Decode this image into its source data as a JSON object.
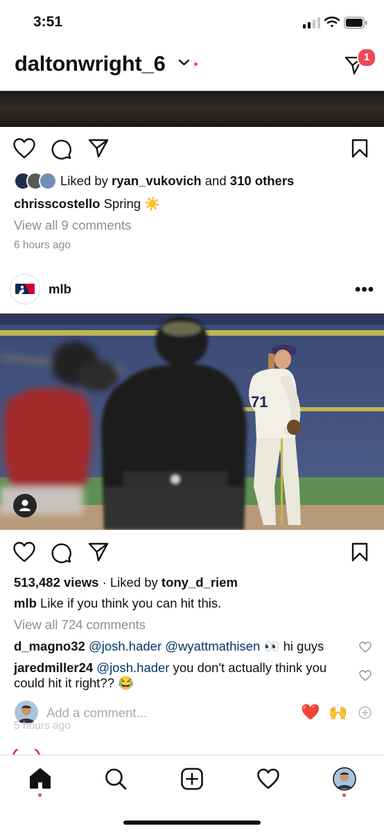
{
  "status_bar": {
    "time": "3:51",
    "signal_icon": "cellular-signal-icon",
    "wifi_icon": "wifi-icon",
    "battery_icon": "battery-icon"
  },
  "header": {
    "username": "daltonwright_6",
    "switch_account_icon": "chevron-down-icon",
    "direct_icon": "paper-plane-icon",
    "direct_badge": "1"
  },
  "post1": {
    "liked_prefix": "Liked by",
    "liked_user": "ryan_vukovich",
    "liked_and": "and",
    "liked_others": "310 others",
    "caption_user": "chrisscostello",
    "caption_text": "Spring",
    "caption_emoji": "☀️",
    "view_all": "View all 9 comments",
    "time_ago": "6 hours ago"
  },
  "post2": {
    "username": "mlb",
    "more_label": "•••",
    "jersey_number": "71",
    "views": "513,482 views",
    "dot": "·",
    "liked_prefix": "Liked by",
    "liked_user": "tony_d_riem",
    "caption_user": "mlb",
    "caption_text": "Like if you think you can hit this.",
    "view_all": "View all 724 comments",
    "comments": [
      {
        "user": "d_magno32",
        "mentions": "@josh.hader @wyattmathisen",
        "emoji": "👀",
        "text": "hi guys"
      },
      {
        "user": "jaredmiller24",
        "mentions": "@josh.hader",
        "text": "you don't actually think you could hit it right??",
        "emoji": "😂"
      }
    ],
    "add_comment_placeholder": "Add a comment...",
    "quick_reactions": [
      "❤️",
      "🙌"
    ],
    "time_ago": "5 hours ago"
  },
  "tab_bar": {
    "items": [
      "home-icon",
      "search-icon",
      "new-post-icon",
      "activity-heart-icon",
      "profile-avatar"
    ]
  },
  "colors": {
    "accent_red": "#ed4956",
    "link_blue": "#00376b",
    "muted_grey": "#8e8e8e"
  }
}
